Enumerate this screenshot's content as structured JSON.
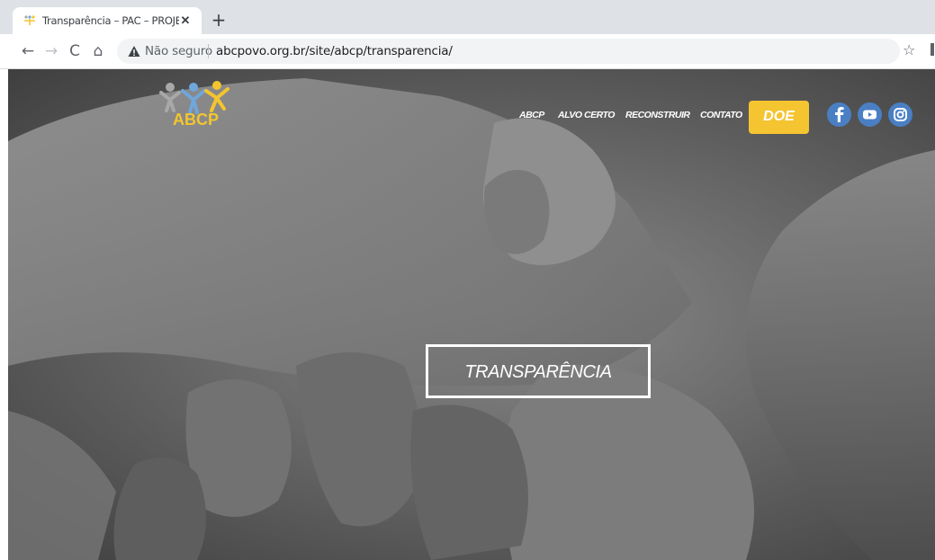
{
  "browser": {
    "tab": {
      "title": "Transparência – PAC – PROJETO A",
      "favicon": "abcp-favicon-icon",
      "close_icon": "close-icon"
    },
    "new_tab_icon": "plus-icon",
    "nav": {
      "back_icon": "back-arrow-icon",
      "forward_icon": "forward-arrow-icon",
      "reload_icon": "reload-icon",
      "home_icon": "home-icon"
    },
    "omnibox": {
      "security_icon": "warning-triangle-icon",
      "security_label": "Não seguro",
      "url": "abcpovo.org.br/site/abcp/transparencia/"
    },
    "bookmark_icon": "star-icon"
  },
  "site": {
    "logo_text": "ABCP",
    "nav_items": [
      "ABCP",
      "ALVO CERTO",
      "RECONSTRUIR",
      "CONTATO"
    ],
    "donate_label": "DOE",
    "social": [
      {
        "name": "facebook-icon"
      },
      {
        "name": "youtube-icon"
      },
      {
        "name": "instagram-icon"
      }
    ],
    "hero_title": "TRANSPARÊNCIA"
  },
  "colors": {
    "donate_bg": "#f5c431",
    "social_bg": "#4a7fc4",
    "logo_yellow": "#f3c52f",
    "logo_blue": "#6fa6dc"
  }
}
